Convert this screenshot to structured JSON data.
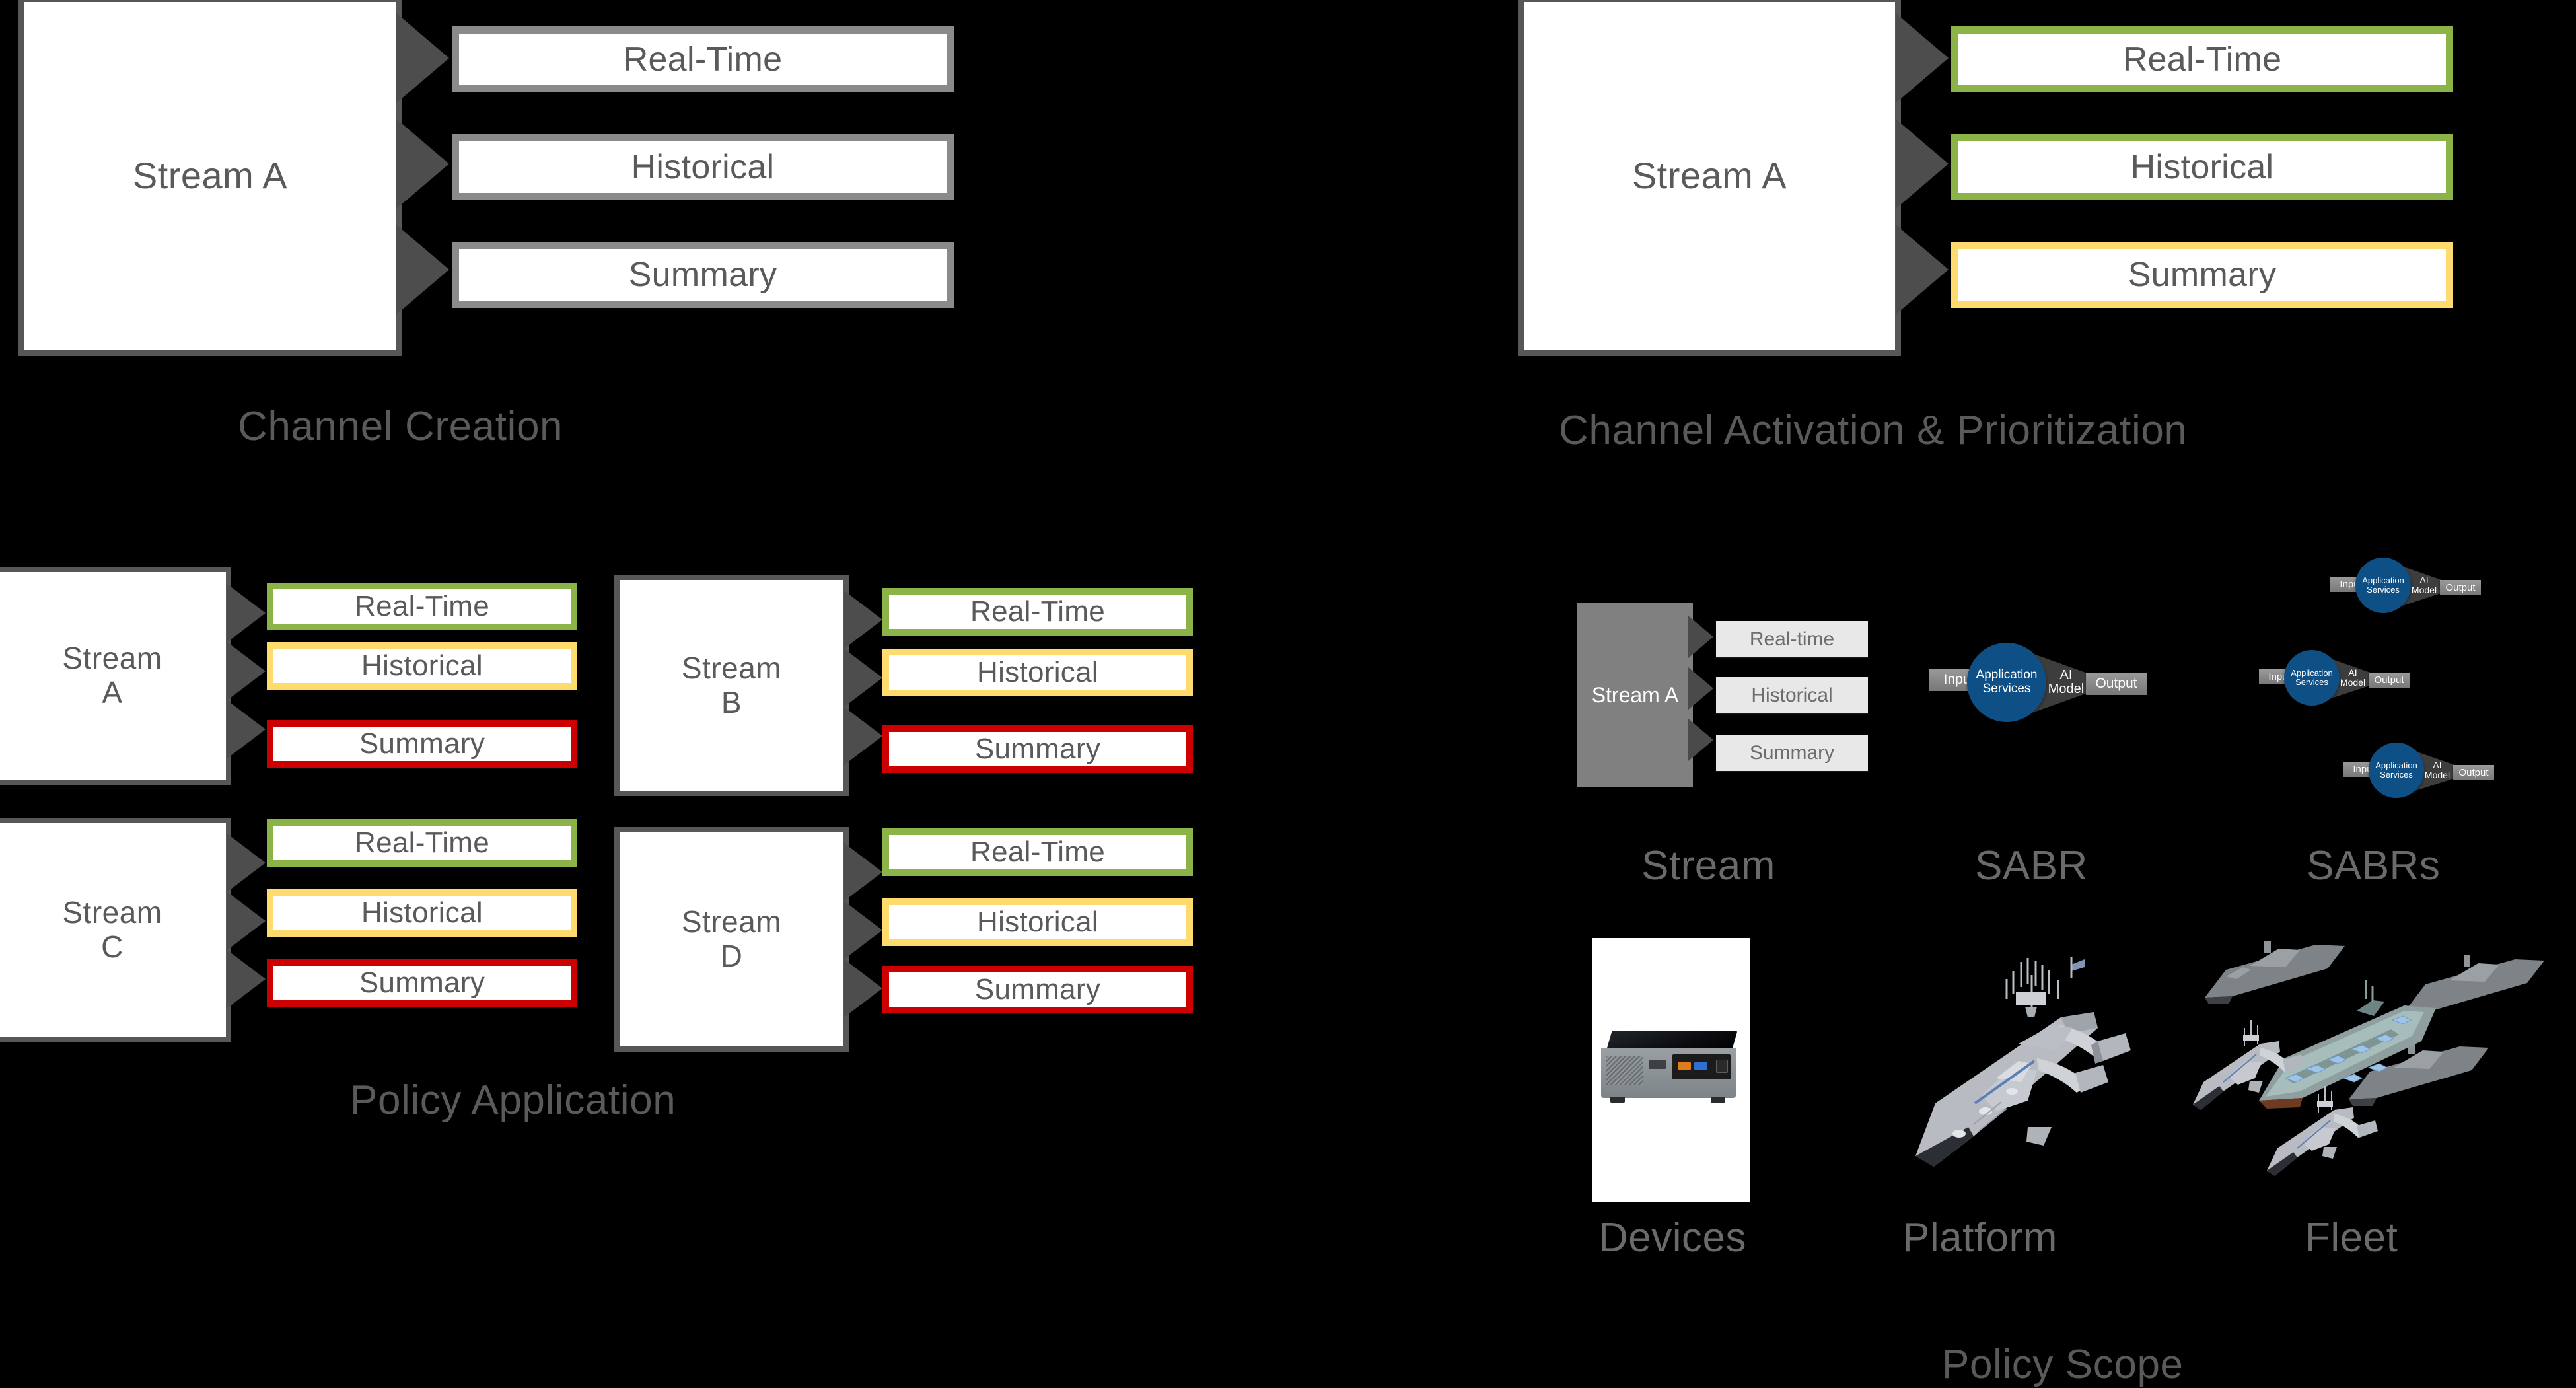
{
  "panels": {
    "channel_creation": {
      "caption": "Channel Creation",
      "stream_label": "Stream A",
      "channels": [
        {
          "label": "Real-Time",
          "accent": "#8a8a8a",
          "state": "inactive"
        },
        {
          "label": "Historical",
          "accent": "#8a8a8a",
          "state": "inactive"
        },
        {
          "label": "Summary",
          "accent": "#8a8a8a",
          "state": "inactive"
        }
      ]
    },
    "channel_activation": {
      "caption": "Channel Activation & Prioritization",
      "stream_label": "Stream A",
      "channels": [
        {
          "label": "Real-Time",
          "accent": "#8cb348",
          "state": "high"
        },
        {
          "label": "Historical",
          "accent": "#8cb348",
          "state": "high"
        },
        {
          "label": "Summary",
          "accent": "#ffdb6e",
          "state": "medium"
        }
      ]
    },
    "policy_application": {
      "caption": "Policy Application",
      "streams": [
        {
          "stream_label": "Stream\nA",
          "channels": [
            {
              "label": "Real-Time",
              "accent": "#8cb348"
            },
            {
              "label": "Historical",
              "accent": "#ffdb6e"
            },
            {
              "label": "Summary",
              "accent": "#cc0000"
            }
          ]
        },
        {
          "stream_label": "Stream\nB",
          "channels": [
            {
              "label": "Real-Time",
              "accent": "#8cb348"
            },
            {
              "label": "Historical",
              "accent": "#ffdb6e"
            },
            {
              "label": "Summary",
              "accent": "#cc0000"
            }
          ]
        },
        {
          "stream_label": "Stream\nC",
          "channels": [
            {
              "label": "Real-Time",
              "accent": "#8cb348"
            },
            {
              "label": "Historical",
              "accent": "#ffdb6e"
            },
            {
              "label": "Summary",
              "accent": "#cc0000"
            }
          ]
        },
        {
          "stream_label": "Stream\nD",
          "channels": [
            {
              "label": "Real-Time",
              "accent": "#8cb348"
            },
            {
              "label": "Historical",
              "accent": "#ffdb6e"
            },
            {
              "label": "Summary",
              "accent": "#cc0000"
            }
          ]
        }
      ]
    },
    "policy_scope": {
      "caption": "Policy Scope",
      "items": [
        {
          "label": "Stream",
          "icon": "stream-channels-icon"
        },
        {
          "label": "SABR",
          "icon": "sabr-pipeline-icon"
        },
        {
          "label": "SABRs",
          "icon": "sabr-pipeline-cluster-icon"
        },
        {
          "label": "Devices",
          "icon": "mini-pc-device-icon"
        },
        {
          "label": "Platform",
          "icon": "naval-trimaran-icon"
        },
        {
          "label": "Fleet",
          "icon": "naval-fleet-icon"
        }
      ],
      "mini_stream": {
        "stream_label": "Stream A",
        "channels": [
          "Real-time",
          "Historical",
          "Summary"
        ]
      },
      "sabr": {
        "input_label": "Input",
        "services_label_line1": "Application",
        "services_label_line2": "Services",
        "model_label_line1": "AI",
        "model_label_line2": "Model",
        "output_label": "Output"
      }
    }
  },
  "colors": {
    "background": "#000000",
    "box_border": "#575757",
    "arrow": "#4d4d4d",
    "text_gray": "#5a5a5a",
    "accent_green": "#8cb348",
    "accent_yellow": "#ffdb6e",
    "accent_red": "#cc0000",
    "accent_gray": "#8a8a8a",
    "sabr_blue": "#0e4f86"
  }
}
